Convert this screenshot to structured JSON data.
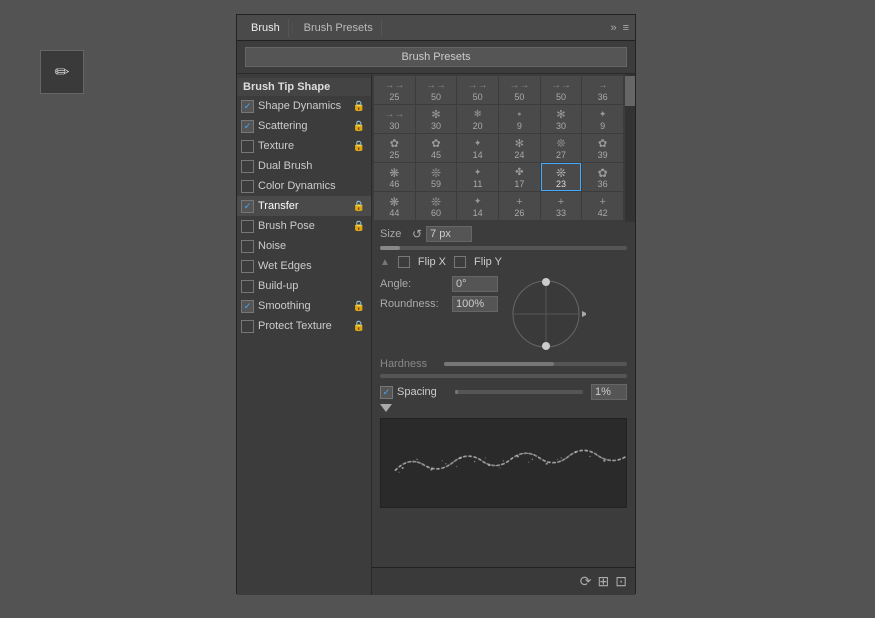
{
  "toolbar": {
    "tool_icon": "✏",
    "title": "Brush"
  },
  "panel": {
    "tabs": [
      {
        "label": "Brush",
        "active": true
      },
      {
        "label": "Brush Presets",
        "active": false
      }
    ],
    "brush_presets_btn": "Brush Presets",
    "panel_menu_icon": "≡",
    "panel_expand_icon": "»"
  },
  "sidebar": {
    "header": "Brush Tip Shape",
    "items": [
      {
        "label": "Shape Dynamics",
        "checked": true,
        "has_lock": true
      },
      {
        "label": "Scattering",
        "checked": true,
        "has_lock": true
      },
      {
        "label": "Texture",
        "checked": false,
        "has_lock": true
      },
      {
        "label": "Dual Brush",
        "checked": false,
        "has_lock": false
      },
      {
        "label": "Color Dynamics",
        "checked": false,
        "has_lock": false
      },
      {
        "label": "Transfer",
        "checked": true,
        "has_lock": true,
        "highlighted": true
      },
      {
        "label": "Brush Pose",
        "checked": false,
        "has_lock": true
      },
      {
        "label": "Noise",
        "checked": false,
        "has_lock": false
      },
      {
        "label": "Wet Edges",
        "checked": false,
        "has_lock": false
      },
      {
        "label": "Build-up",
        "checked": false,
        "has_lock": false
      },
      {
        "label": "Smoothing",
        "checked": true,
        "has_lock": true
      },
      {
        "label": "Protect Texture",
        "checked": false,
        "has_lock": true
      }
    ]
  },
  "brush_grid": {
    "cells": [
      {
        "num": "25",
        "type": "arrow"
      },
      {
        "num": "50",
        "type": "arrow"
      },
      {
        "num": "50",
        "type": "arrow"
      },
      {
        "num": "50",
        "type": "arrow"
      },
      {
        "num": "50",
        "type": "arrow"
      },
      {
        "num": "36",
        "type": "arrow"
      },
      {
        "num": "30",
        "type": "arrow"
      },
      {
        "num": "30",
        "type": "arrow"
      },
      {
        "num": "20",
        "type": "star"
      },
      {
        "num": "9",
        "type": "dot"
      },
      {
        "num": "30",
        "type": "star"
      },
      {
        "num": "9",
        "type": "star"
      },
      {
        "num": "25",
        "type": "star"
      },
      {
        "num": "45",
        "type": "star"
      },
      {
        "num": "14",
        "type": "star"
      },
      {
        "num": "24",
        "type": "star"
      },
      {
        "num": "27",
        "type": "star"
      },
      {
        "num": "39",
        "type": "star"
      },
      {
        "num": "46",
        "type": "star"
      },
      {
        "num": "59",
        "type": "star"
      },
      {
        "num": "11",
        "type": "star"
      },
      {
        "num": "17",
        "type": "star"
      },
      {
        "num": "23",
        "type": "star",
        "selected": true
      },
      {
        "num": "36",
        "type": "star"
      },
      {
        "num": "44",
        "type": "star"
      },
      {
        "num": "60",
        "type": "star"
      },
      {
        "num": "14",
        "type": "star"
      },
      {
        "num": "26",
        "type": "plus"
      },
      {
        "num": "33",
        "type": "plus"
      },
      {
        "num": "42",
        "type": "plus"
      }
    ]
  },
  "controls": {
    "size_label": "Size",
    "size_reset_icon": "↺",
    "size_value": "7 px",
    "flip_x_label": "Flip X",
    "flip_y_label": "Flip Y",
    "angle_label": "Angle:",
    "angle_value": "0°",
    "roundness_label": "Roundness:",
    "roundness_value": "100%",
    "hardness_label": "Hardness",
    "spacing_label": "Spacing",
    "spacing_value": "1%",
    "spacing_checked": true
  },
  "bottom_toolbar": {
    "icons": [
      "⟳",
      "⊞",
      "⊡"
    ]
  },
  "brush_strokes": {
    "description": "wavy brush stroke preview"
  }
}
